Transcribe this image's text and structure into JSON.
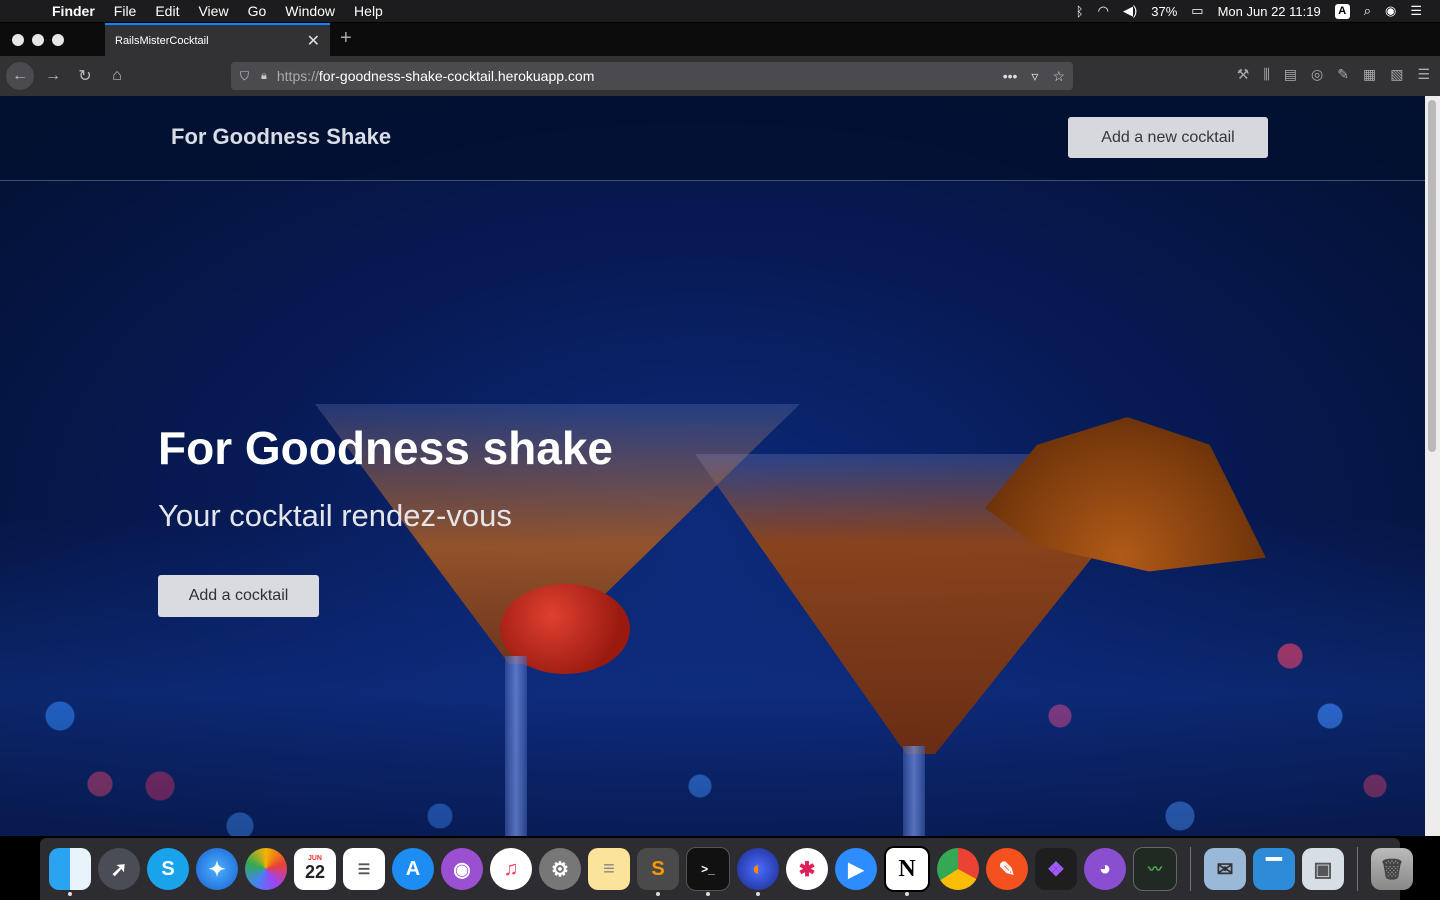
{
  "menubar": {
    "apple": "",
    "app": "Finder",
    "items": [
      "File",
      "Edit",
      "View",
      "Go",
      "Window",
      "Help"
    ],
    "battery": "37%",
    "datetime": "Mon Jun 22  11:19",
    "input_badge": "A"
  },
  "browser": {
    "tab_title": "RailsMisterCocktail",
    "tab_close": "✕",
    "new_tab": "+",
    "url_scheme": "https://",
    "url_host": "for-goodness-shake-cocktail.herokuapp.com"
  },
  "site": {
    "brand": "For Goodness Shake",
    "nav_button": "Add a new cocktail",
    "hero_title": "For Goodness shake",
    "hero_subtitle": "Your cocktail rendez-vous",
    "hero_button": "Add a cocktail"
  },
  "dock": {
    "icons": [
      "finder",
      "launchpad",
      "skype",
      "safari",
      "photos",
      "calendar",
      "reminders",
      "app-store",
      "podcasts",
      "music",
      "system-preferences",
      "notes",
      "sublime-text",
      "terminal",
      "firefox",
      "slack",
      "zoom",
      "notion",
      "chrome",
      "paw",
      "figma",
      "github-desktop",
      "activity-monitor",
      "preview",
      "keynote",
      "image-capture",
      "trash"
    ],
    "calendar_month": "JUN",
    "calendar_day": "22"
  }
}
